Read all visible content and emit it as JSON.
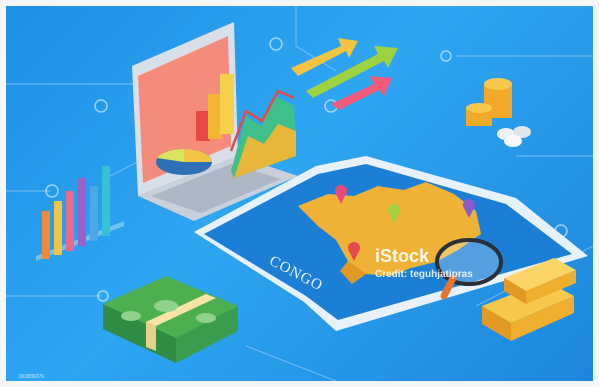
{
  "map": {
    "country_label": "CONGO"
  },
  "watermark": {
    "brand": "iStock",
    "credit": "Credit: teguhjatipras"
  },
  "image_id": "963836376",
  "colors": {
    "background": "#2ea6f2",
    "map_paper": "#1b7fd6",
    "country": "#f0b234",
    "laptop_screen": "#f58b7a",
    "money": "#2f8d43",
    "gold": "#f5b63a"
  },
  "icons": [
    "laptop-icon",
    "bar-chart-icon",
    "arrows-icon",
    "coins-icon",
    "map-icon",
    "location-pin-icon",
    "money-stack-icon",
    "gold-bar-icon",
    "magnifier-icon"
  ]
}
